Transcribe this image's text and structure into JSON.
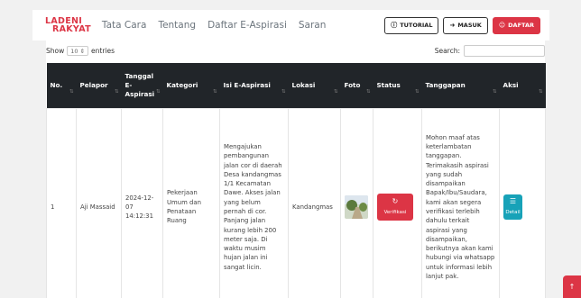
{
  "brand": {
    "line1": "LADENI",
    "line2": "RAKYAT",
    "color": "#dc3545"
  },
  "nav": {
    "links": [
      "Tata Cara",
      "Tentang",
      "Daftar E-Aspirasi",
      "Saran"
    ],
    "buttons": {
      "tutorial": "TUTORIAL",
      "masuk": "MASUK",
      "daftar": "DAFTAR"
    }
  },
  "table_controls": {
    "show_label": "Show",
    "entries_value": "10",
    "entries_label": "entries",
    "search_label": "Search:"
  },
  "table": {
    "columns": [
      "No.",
      "Pelapor",
      "Tanggal E-Aspirasi",
      "Kategori",
      "Isi E-Aspirasi",
      "Lokasi",
      "Foto",
      "Status",
      "Tanggapan",
      "Aksi"
    ],
    "rows": [
      {
        "no": "1",
        "pelapor": "Aji Massaid",
        "tanggal": "2024-12-07 14:12:31",
        "kategori": "Pekerjaan Umum dan Penataan Ruang",
        "isi": "Mengajukan pembangunan jalan cor di daerah Desa kandangmas 1/1 Kecamatan Dawe. Akses jalan yang belum pernah di cor. Panjang jalan kurang lebih 200 meter saja. Di waktu musim hujan jalan ini sangat licin.",
        "lokasi": "Kandangmas",
        "status": "Verifikasi",
        "tanggapan": "Mohon maaf atas keterlambatan tanggapan. Terimakasih aspirasi yang sudah disampaikan Bapak/Ibu/Saudara, kami akan segera verifikasi terlebih dahulu terkait aspirasi yang disampaikan, berikutnya akan kami hubungi via whatsapp untuk informasi lebih lanjut pak.",
        "aksi": "Detail"
      }
    ]
  },
  "colors": {
    "danger": "#dc3545",
    "info": "#17a2b8",
    "header_bg": "#212529"
  },
  "icons": {
    "tutorial": "info-circle-icon",
    "masuk": "sign-in-icon",
    "daftar": "user-plus-icon",
    "status": "sync-icon",
    "detail": "list-icon",
    "float": "arrow-up-icon"
  }
}
